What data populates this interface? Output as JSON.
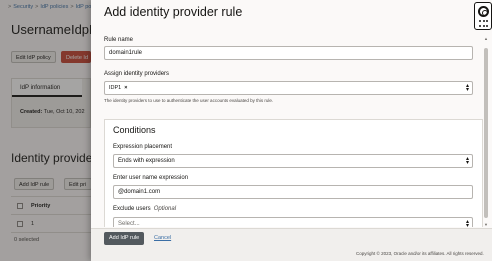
{
  "breadcrumb": {
    "items": [
      "Security",
      "IdP policies",
      "IdP pol"
    ]
  },
  "background": {
    "title": "UsernameIdpP",
    "edit_button": "Edit IdP policy",
    "delete_button": "Delete Id",
    "tab": "IdP information",
    "created_label": "Created:",
    "created_value": "Tue, Oct 10, 202",
    "section_title": "Identity provide",
    "add_rule_button": "Add IdP rule",
    "edit_rule_button": "Edit pri",
    "table_header": "Priority",
    "table_row_value": "1",
    "selected_count": "0 selected"
  },
  "panel": {
    "title": "Add identity provider rule",
    "rule_name_label": "Rule name",
    "rule_name_value": "domain1rule",
    "assign_label": "Assign identity providers",
    "assign_chip": "IDP1",
    "assign_chip_remove": "×",
    "assign_hint": "The identity providers to use to authenticate the user accounts evaluated by this rule.",
    "conditions": {
      "title": "Conditions",
      "placement_label": "Expression placement",
      "placement_value": "Ends with expression",
      "expression_label": "Enter user name expression",
      "expression_value": "@domain1.com",
      "exclude_label": "Exclude users",
      "exclude_optional": "Optional",
      "exclude_placeholder": "Select..."
    },
    "footer": {
      "primary_button": "Add IdP rule",
      "cancel_link": "Cancel",
      "copyright": "Copyright © 2023, Oracle and/or its affiliates. All rights reserved."
    }
  },
  "colors": {
    "accent_link": "#3b6ea5",
    "primary_button": "#53595e",
    "danger_button": "#c74634"
  },
  "icons": {
    "help": "lifebuoy-icon",
    "dropdown": "updown-chevron-icon"
  }
}
